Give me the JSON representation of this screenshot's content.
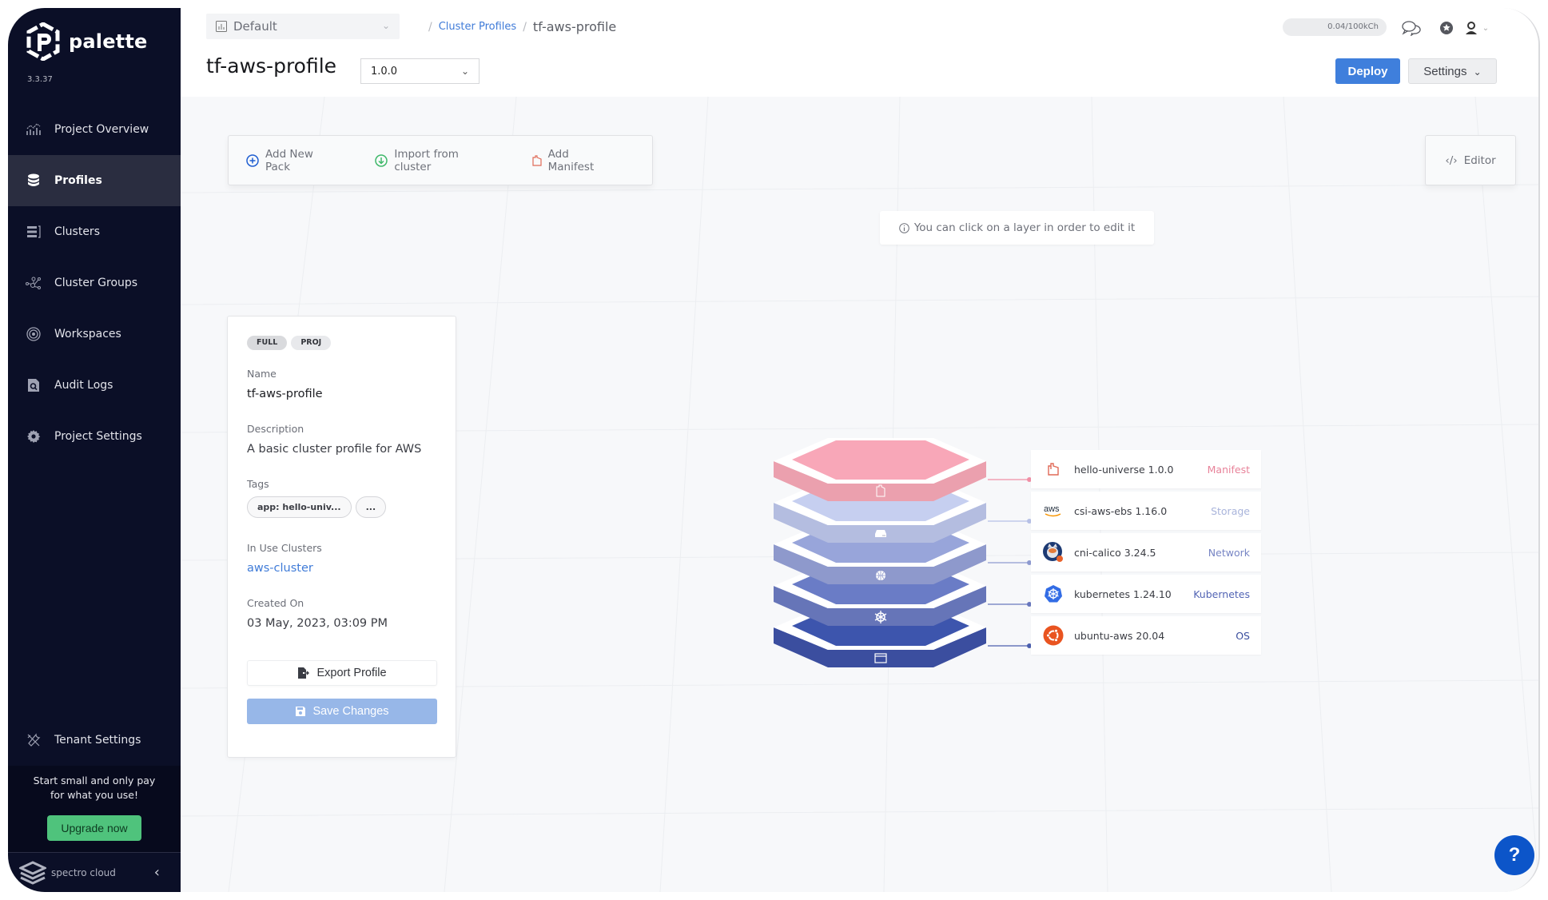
{
  "app": {
    "brand": "palette",
    "version": "3.3.37"
  },
  "sidebar": {
    "items": [
      {
        "label": "Project Overview",
        "icon": "chart-icon",
        "active": false
      },
      {
        "label": "Profiles",
        "icon": "database-stack-icon",
        "active": true
      },
      {
        "label": "Clusters",
        "icon": "server-rack-icon",
        "active": false
      },
      {
        "label": "Cluster Groups",
        "icon": "nodes-network-icon",
        "active": false
      },
      {
        "label": "Workspaces",
        "icon": "target-rings-icon",
        "active": false
      },
      {
        "label": "Audit Logs",
        "icon": "search-document-icon",
        "active": false
      },
      {
        "label": "Project Settings",
        "icon": "gear-icon",
        "active": false
      }
    ],
    "tenant_settings": "Tenant Settings",
    "promo_line1": "Start small and only pay",
    "promo_line2": "for what you use!",
    "upgrade_label": "Upgrade now",
    "footer_brand": "spectro cloud"
  },
  "header": {
    "project_select": "Default",
    "breadcrumb": {
      "parent": "Cluster Profiles",
      "current": "tf-aws-profile"
    },
    "title": "tf-aws-profile",
    "version_select": "1.0.0",
    "credits": "0.04/100kCh",
    "deploy_label": "Deploy",
    "settings_label": "Settings"
  },
  "toolbar": {
    "add_pack": "Add New Pack",
    "import": "Import from cluster",
    "add_manifest": "Add Manifest",
    "editor": "Editor",
    "hint": "You can click on a layer in order to edit it"
  },
  "profile_card": {
    "chips": [
      "FULL",
      "PROJ"
    ],
    "name_label": "Name",
    "name": "tf-aws-profile",
    "description_label": "Description",
    "description": "A basic cluster profile for AWS",
    "tags_label": "Tags",
    "tags": [
      "app: hello-univ...",
      "..."
    ],
    "in_use_label": "In Use Clusters",
    "in_use_cluster": "aws-cluster",
    "created_label": "Created On",
    "created": "03 May, 2023, 03:09 PM",
    "export_label": "Export Profile",
    "save_label": "Save Changes"
  },
  "layers": [
    {
      "name": "hello-universe 1.0.0",
      "type": "Manifest",
      "type_color": "#e8839a",
      "logo": "manifest-icon",
      "top": "#f8a7b8",
      "side": "#eba0ae",
      "line": "#f08fa5"
    },
    {
      "name": "csi-aws-ebs 1.16.0",
      "type": "Storage",
      "type_color": "#a9b4db",
      "logo": "aws-logo-icon",
      "top": "#c6cff0",
      "side": "#b4bde0",
      "line": "#b6c0e6"
    },
    {
      "name": "cni-calico 3.24.5",
      "type": "Network",
      "type_color": "#7785c4",
      "logo": "calico-logo-icon",
      "top": "#98a5da",
      "side": "#8e99cc",
      "line": "#8e9ad0"
    },
    {
      "name": "kubernetes 1.24.10",
      "type": "Kubernetes",
      "type_color": "#5264b4",
      "logo": "kubernetes-logo-icon",
      "top": "#6a7cc6",
      "side": "#6675b8",
      "line": "#6877bd"
    },
    {
      "name": "ubuntu-aws 20.04",
      "type": "OS",
      "type_color": "#3a4e9e",
      "logo": "ubuntu-logo-icon",
      "top": "#3d55ad",
      "side": "#3b4e9f",
      "line": "#4b5fae"
    }
  ]
}
